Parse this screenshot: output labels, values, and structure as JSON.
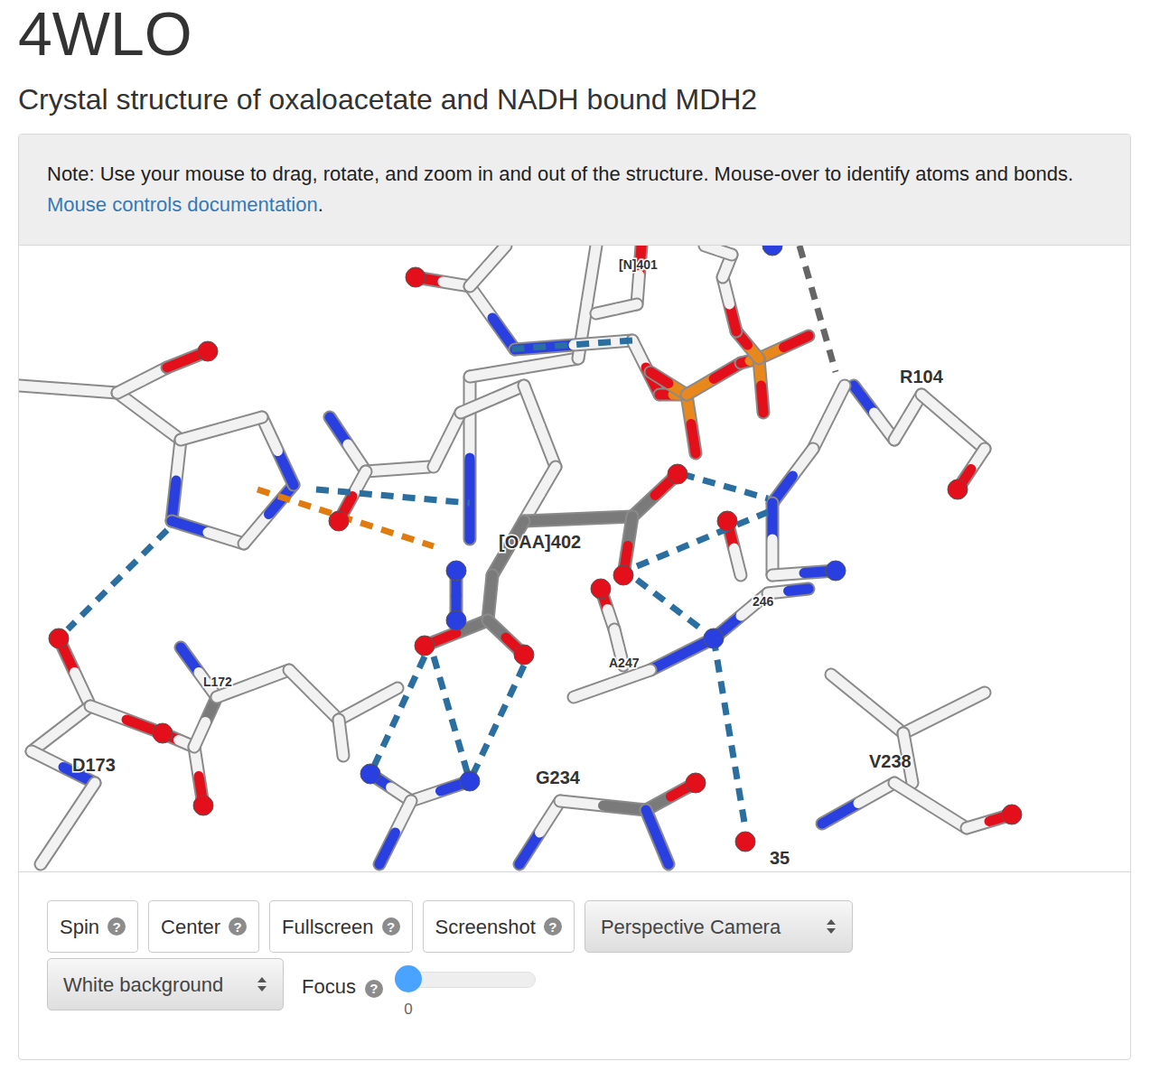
{
  "page": {
    "title": "4WLO",
    "subtitle": "Crystal structure of oxaloacetate and NADH bound MDH2"
  },
  "note": {
    "text": "Note: Use your mouse to drag, rotate, and zoom in and out of the structure. Mouse-over to identify atoms and bonds. ",
    "link": "Mouse controls documentation",
    "end": "."
  },
  "viewer": {
    "labels": [
      {
        "text": "[N]401",
        "small": true
      },
      {
        "text": "R104",
        "small": false
      },
      {
        "text": "[OAA]402",
        "small": false
      },
      {
        "text": "246",
        "small": true
      },
      {
        "text": "A247",
        "small": true
      },
      {
        "text": "L172",
        "small": true
      },
      {
        "text": "D173",
        "small": false
      },
      {
        "text": "G234",
        "small": false
      },
      {
        "text": "V238",
        "small": false
      },
      {
        "text": "35",
        "small": false
      }
    ]
  },
  "controls": {
    "help_icon": "?",
    "buttons": [
      {
        "label": "Spin"
      },
      {
        "label": "Center"
      },
      {
        "label": "Fullscreen"
      },
      {
        "label": "Screenshot"
      }
    ],
    "camera_select": {
      "value": "Perspective Camera"
    },
    "background_select": {
      "value": "White background"
    },
    "focus": {
      "label": "Focus",
      "level": 0,
      "reading": "0"
    }
  }
}
